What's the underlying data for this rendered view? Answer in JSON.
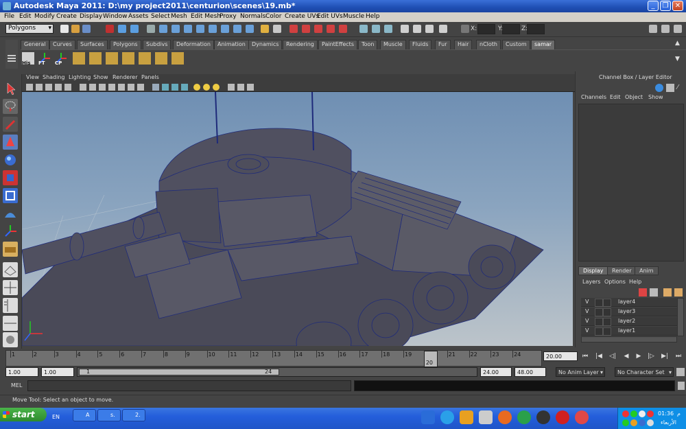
{
  "window": {
    "title": "Autodesk Maya 2011: D:\\my project2011\\centurion\\scenes\\19.mb*"
  },
  "menus": [
    "File",
    "Edit",
    "Modify",
    "Create",
    "Display",
    "Window",
    "Assets",
    "Select",
    "Mesh",
    "Edit Mesh",
    "Proxy",
    "Normals",
    "Color",
    "Create UVs",
    "Edit UVs",
    "Muscle",
    "Help"
  ],
  "status_line": {
    "mode": "Polygons",
    "x_label": "X:",
    "y_label": "Y:",
    "z_label": "Z:"
  },
  "shelf": {
    "tabs": [
      "General",
      "Curves",
      "Surfaces",
      "Polygons",
      "Subdivs",
      "Deformation",
      "Animation",
      "Dynamics",
      "Rendering",
      "PaintEffects",
      "Toon",
      "Muscle",
      "Fluids",
      "Fur",
      "Hair",
      "nCloth",
      "Custom",
      "samar"
    ],
    "active_tab": "samar",
    "buttons": [
      "His",
      "FT",
      "CP"
    ]
  },
  "viewport": {
    "menus": [
      "View",
      "Shading",
      "Lighting",
      "Show",
      "Renderer",
      "Panels"
    ]
  },
  "channel_box": {
    "title": "Channel Box / Layer Editor",
    "menus": [
      "Channels",
      "Edit",
      "Object",
      "Show"
    ]
  },
  "layer_editor": {
    "tabs": [
      "Display",
      "Render",
      "Anim"
    ],
    "active_tab": "Display",
    "menus": [
      "Layers",
      "Options",
      "Help"
    ],
    "layers": [
      {
        "visible": "V",
        "name": "layer4"
      },
      {
        "visible": "V",
        "name": "layer3"
      },
      {
        "visible": "V",
        "name": "layer2"
      },
      {
        "visible": "V",
        "name": "layer1"
      }
    ]
  },
  "time_slider": {
    "ticks": [
      "1",
      "2",
      "3",
      "4",
      "5",
      "6",
      "7",
      "8",
      "9",
      "10",
      "11",
      "12",
      "13",
      "14",
      "15",
      "16",
      "17",
      "18",
      "19",
      "20",
      "21",
      "22",
      "23",
      "24"
    ],
    "current_frame": "20",
    "current_time_field": "20.00"
  },
  "range_slider": {
    "start_time": "1.00",
    "playback_start": "1.00",
    "range_start_label": "1",
    "range_end_label": "24",
    "playback_end": "24.00",
    "end_time": "48.00",
    "anim_layer": "No Anim Layer",
    "character_set": "No Character Set"
  },
  "command_line": {
    "label": "MEL"
  },
  "help_line": {
    "text": "Move Tool: Select an object to move."
  },
  "taskbar": {
    "start_label": "start",
    "language": "EN",
    "tasks": [
      "A",
      "s.",
      "2."
    ],
    "clock": "01:36",
    "clock_suffix": "م",
    "day": "الأربعاء"
  }
}
